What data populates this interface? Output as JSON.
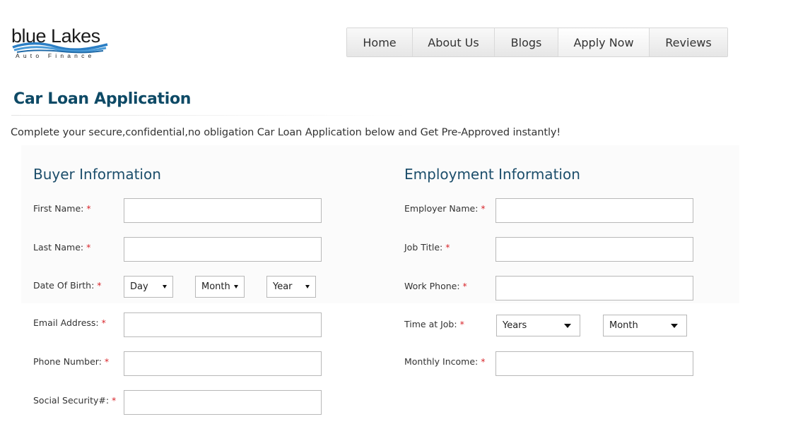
{
  "brand": {
    "name": "blue Lakes",
    "tagline": "Auto Finance"
  },
  "nav": {
    "items": [
      {
        "label": "Home"
      },
      {
        "label": "About Us"
      },
      {
        "label": "Blogs"
      },
      {
        "label": "Apply Now"
      },
      {
        "label": "Reviews"
      }
    ]
  },
  "page": {
    "title": "Car Loan Application",
    "intro": "Complete your secure,confidential,no obligation Car Loan Application below and Get Pre-Approved instantly!"
  },
  "buyer": {
    "title": "Buyer Information",
    "first_name": {
      "label": "First Name:",
      "required": "*",
      "value": ""
    },
    "last_name": {
      "label": "Last Name:",
      "required": "*",
      "value": ""
    },
    "dob": {
      "label": "Date Of Birth:",
      "required": "*",
      "day": "Day",
      "month": "Month",
      "year": "Year"
    },
    "email": {
      "label": "Email Address:",
      "required": "*",
      "value": ""
    },
    "phone": {
      "label": "Phone Number:",
      "required": "*",
      "value": ""
    },
    "ssn": {
      "label": "Social Security#:",
      "required": "*",
      "value": ""
    }
  },
  "employment": {
    "title": "Employment Information",
    "employer": {
      "label": "Employer Name:",
      "required": "*",
      "value": ""
    },
    "job_title": {
      "label": "Job Title:",
      "required": "*",
      "value": ""
    },
    "work_phone": {
      "label": "Work Phone:",
      "required": "*",
      "value": ""
    },
    "time_at_job": {
      "label": "Time at Job:",
      "required": "*",
      "years": "Years",
      "month": "Month"
    },
    "monthly_income": {
      "label": "Monthly Income:",
      "required": "*",
      "value": ""
    }
  },
  "colors": {
    "title": "#0e4a66",
    "section": "#1c4e6b",
    "required": "#d8262c",
    "logo_wave": "#2b7ec4"
  }
}
